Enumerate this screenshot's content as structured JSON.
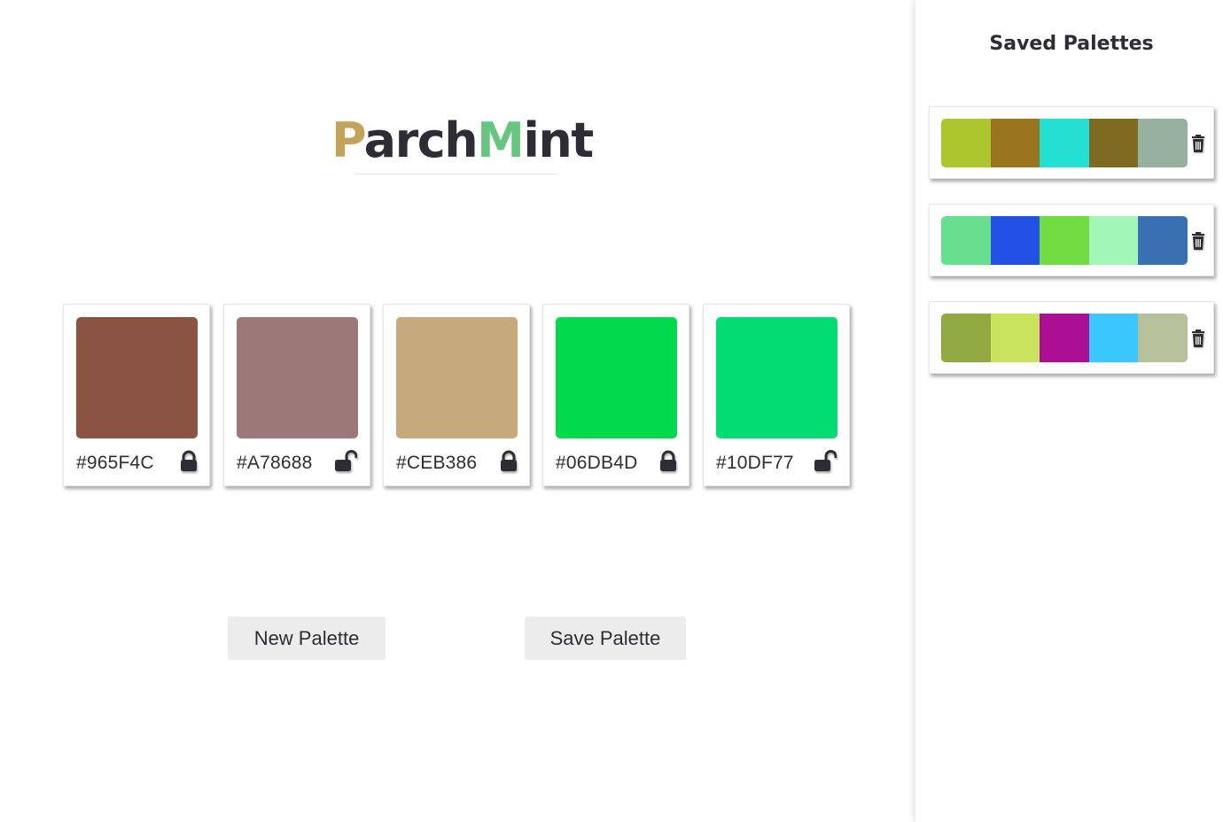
{
  "app": {
    "logo": {
      "first_letter": "P",
      "part1": "arch",
      "second_letter": "M",
      "part2": "int"
    },
    "accent_colors": {
      "parchment": "#c5a25a",
      "mint": "#66c57f",
      "text": "#2e2c35"
    }
  },
  "palette": {
    "colors": [
      {
        "hex": "#965F4C",
        "swatch": "#8B5442",
        "locked": true
      },
      {
        "hex": "#A78688",
        "swatch": "#9D7878",
        "locked": false
      },
      {
        "hex": "#CEB386",
        "swatch": "#C6AA7B",
        "locked": true
      },
      {
        "hex": "#06DB4D",
        "swatch": "#02D94D",
        "locked": true
      },
      {
        "hex": "#10DF77",
        "swatch": "#02DC73",
        "locked": false
      }
    ]
  },
  "actions": {
    "new_label": "New Palette",
    "save_label": "Save Palette"
  },
  "sidebar": {
    "title": "Saved Palettes",
    "palettes": [
      {
        "colors": [
          "#ADC62E",
          "#9A751D",
          "#24E0D2",
          "#7F6A21",
          "#97B0A0"
        ]
      },
      {
        "colors": [
          "#68DE8F",
          "#2351E6",
          "#71DC41",
          "#A1F6B8",
          "#3970B2"
        ]
      },
      {
        "colors": [
          "#91A941",
          "#C8E45F",
          "#AB0F94",
          "#3AC7FD",
          "#B6C19B"
        ]
      }
    ]
  },
  "icons": {
    "lock_closed": "lock-icon",
    "lock_open": "unlock-icon",
    "delete": "trash-icon"
  }
}
